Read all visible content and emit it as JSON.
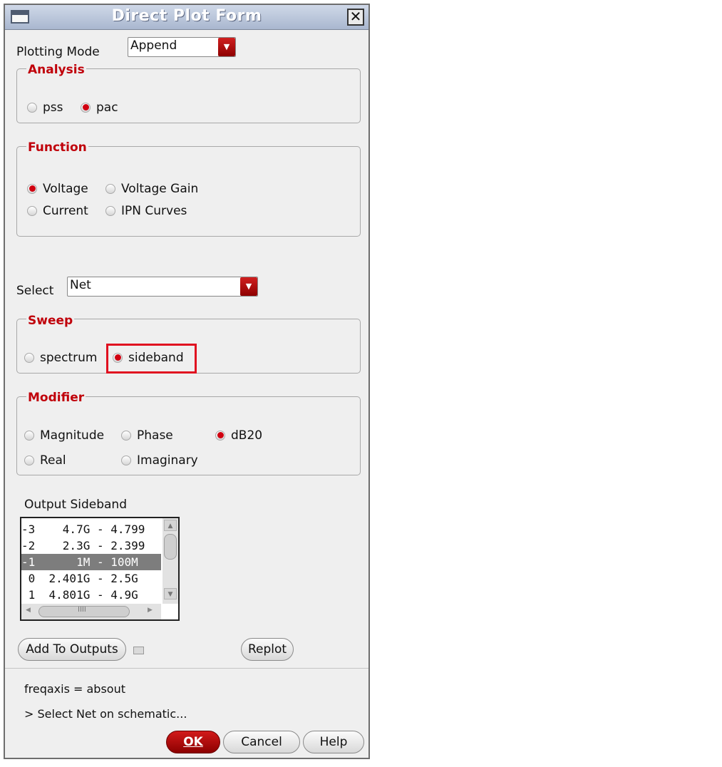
{
  "window": {
    "title": "Direct Plot Form"
  },
  "plotting_mode": {
    "label": "Plotting Mode",
    "value": "Append"
  },
  "analysis": {
    "title": "Analysis",
    "options": [
      {
        "label": "pss",
        "selected": false
      },
      {
        "label": "pac",
        "selected": true
      }
    ]
  },
  "function": {
    "title": "Function",
    "options": [
      {
        "label": "Voltage",
        "selected": true
      },
      {
        "label": "Voltage Gain",
        "selected": false
      },
      {
        "label": "Current",
        "selected": false
      },
      {
        "label": "IPN Curves",
        "selected": false
      }
    ]
  },
  "select": {
    "label": "Select",
    "value": "Net"
  },
  "sweep": {
    "title": "Sweep",
    "options": [
      {
        "label": "spectrum",
        "selected": false
      },
      {
        "label": "sideband",
        "selected": true
      }
    ]
  },
  "modifier": {
    "title": "Modifier",
    "options": [
      {
        "label": "Magnitude",
        "selected": false
      },
      {
        "label": "Phase",
        "selected": false
      },
      {
        "label": "dB20",
        "selected": true
      },
      {
        "label": "Real",
        "selected": false
      },
      {
        "label": "Imaginary",
        "selected": false
      }
    ]
  },
  "output_sideband": {
    "label": "Output Sideband",
    "rows": [
      {
        "text": "-3    4.7G - 4.799",
        "selected": false
      },
      {
        "text": "-2    2.3G - 2.399",
        "selected": false
      },
      {
        "text": "-1      1M - 100M",
        "selected": true
      },
      {
        "text": " 0  2.401G - 2.5G",
        "selected": false
      },
      {
        "text": " 1  4.801G - 4.9G",
        "selected": false
      }
    ],
    "scroll_hint": "IIII"
  },
  "buttons": {
    "add_to_outputs": "Add To Outputs",
    "replot": "Replot",
    "ok": "OK",
    "cancel": "Cancel",
    "help": "Help"
  },
  "status": {
    "freqaxis": "freqaxis = absout",
    "prompt": "> Select Net on schematic..."
  },
  "colors": {
    "accent": "#c0000a",
    "highlight_box": "#e01020"
  }
}
